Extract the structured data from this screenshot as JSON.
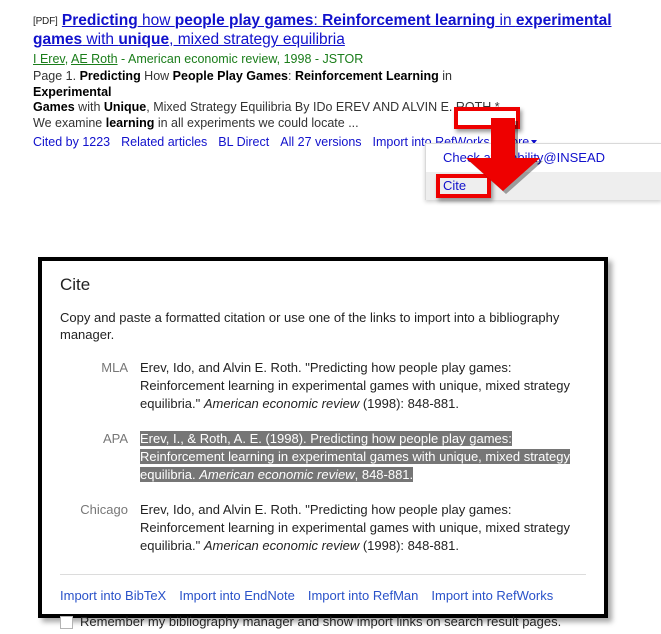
{
  "result": {
    "pdf_tag": "[PDF]",
    "title_parts": [
      {
        "text": "Predicting",
        "bold": true
      },
      {
        "text": " how ",
        "bold": false
      },
      {
        "text": "people play games",
        "bold": true
      },
      {
        "text": ": ",
        "bold": false
      },
      {
        "text": "Reinforcement learning",
        "bold": true
      },
      {
        "text": " in ",
        "bold": false
      },
      {
        "text": "experimental games",
        "bold": true
      },
      {
        "text": " with ",
        "bold": false
      },
      {
        "text": "unique",
        "bold": true
      },
      {
        "text": ", mixed strategy equilibria",
        "bold": false
      }
    ],
    "title_plain": "Predicting how people play games: Reinforcement learning in experimental games with unique, mixed strategy equilibria",
    "authors": [
      "I Erev",
      "AE Roth"
    ],
    "author_separator": ", ",
    "publication": " - American economic review, 1998 - JSTOR",
    "snippet_line1": "Page 1. Predicting How People Play Games: Reinforcement Learning in Experimental",
    "snippet_line2": "Games with Unique, Mixed Strategy Equilibria By IDo EREV AND ALVIN E. ROTH *",
    "snippet_line3": "We examine learning in all experiments we could locate ...",
    "links": [
      "Cited by 1223",
      "Related articles",
      "BL Direct",
      "All 27 versions",
      "Import into RefWorks"
    ],
    "more_label": "More"
  },
  "dropdown": {
    "items": [
      {
        "label": "Check availability@INSEAD",
        "highlight": false
      },
      {
        "label": "Cite",
        "highlight": true
      }
    ]
  },
  "cite_dialog": {
    "heading": "Cite",
    "description": "Copy and paste a formatted citation or use one of the links to import into a bibliography manager.",
    "citations": [
      {
        "style": "MLA",
        "selected": false,
        "text_before": "Erev, Ido, and Alvin E. Roth. \"Predicting how people play games: Reinforcement learning in experimental games with unique, mixed strategy equilibria.\" ",
        "text_italic": "American economic review",
        "text_after": " (1998): 848-881."
      },
      {
        "style": "APA",
        "selected": true,
        "text_before": "Erev, I., & Roth, A. E. (1998). Predicting how people play games: Reinforcement learning in experimental games with unique, mixed strategy equilibria. ",
        "text_italic": "American economic review",
        "text_after": ", 848-881."
      },
      {
        "style": "Chicago",
        "selected": false,
        "text_before": "Erev, Ido, and Alvin E. Roth. \"Predicting how people play games: Reinforcement learning in experimental games with unique, mixed strategy equilibria.\" ",
        "text_italic": "American economic review",
        "text_after": " (1998): 848-881."
      }
    ],
    "import_links": [
      "Import into BibTeX",
      "Import into EndNote",
      "Import into RefMan",
      "Import into RefWorks"
    ],
    "remember_label": "Remember my bibliography manager and show import links on search result pages.",
    "remember_checked": false
  },
  "annotations": {
    "highlight_color": "#ee0000",
    "boxes": [
      "more-button",
      "cite-menu-item"
    ],
    "arrows": [
      "arrow-more-to-cite",
      "arrow-into-cite-box"
    ]
  },
  "colors": {
    "link_blue": "#1111cc",
    "author_green": "#1a7d1a",
    "selection_gray": "#767676",
    "annotation_red": "#ee0000"
  }
}
